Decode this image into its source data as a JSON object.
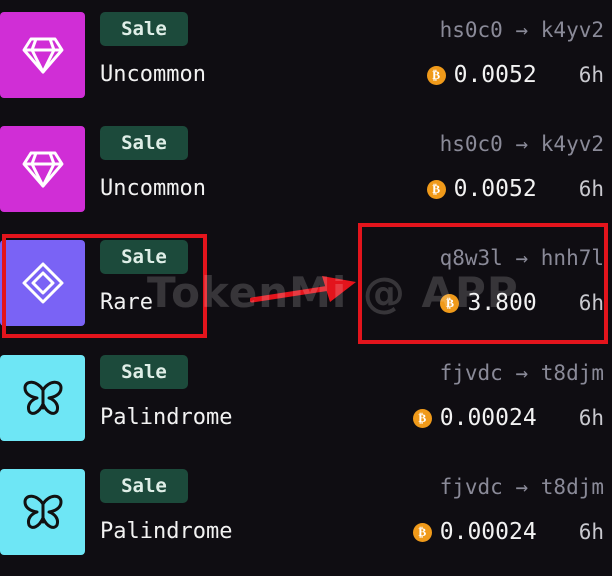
{
  "colors": {
    "background": "#0f0d12",
    "uncommon": "#d02ed6",
    "rare": "#7a63f5",
    "palindrome": "#6ee6f5",
    "badge_bg": "#1c4a3b",
    "coin": "#f09a1a",
    "highlight": "#e3141c"
  },
  "coin_icon": "bitcoin-icon",
  "watermark": "TokenMi @ APP",
  "rows": [
    {
      "icon": "diamond-icon",
      "badge": "Sale",
      "rarity": "Uncommon",
      "from": "hs0c0",
      "arrow": "→",
      "to": "k4yv2",
      "price": "0.0052",
      "age": "6h"
    },
    {
      "icon": "diamond-icon",
      "badge": "Sale",
      "rarity": "Uncommon",
      "from": "hs0c0",
      "arrow": "→",
      "to": "k4yv2",
      "price": "0.0052",
      "age": "6h"
    },
    {
      "icon": "rare-gem-icon",
      "badge": "Sale",
      "rarity": "Rare",
      "from": "q8w3l",
      "arrow": "→",
      "to": "hnh7l",
      "price": "3.800",
      "age": "6h"
    },
    {
      "icon": "butterfly-icon",
      "badge": "Sale",
      "rarity": "Palindrome",
      "from": "fjvdc",
      "arrow": "→",
      "to": "t8djm",
      "price": "0.00024",
      "age": "6h"
    },
    {
      "icon": "butterfly-icon",
      "badge": "Sale",
      "rarity": "Palindrome",
      "from": "fjvdc",
      "arrow": "→",
      "to": "t8djm",
      "price": "0.00024",
      "age": "6h"
    }
  ]
}
